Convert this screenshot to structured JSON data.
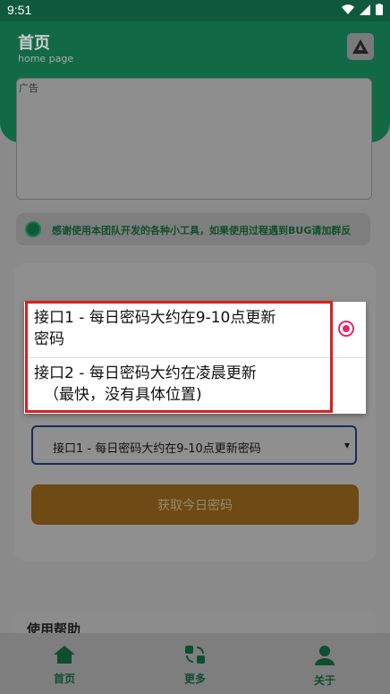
{
  "status": {
    "time": "9:51"
  },
  "header": {
    "title": "首页",
    "subtitle": "home page"
  },
  "ad": {
    "alt": "广告"
  },
  "notice": {
    "text": "感谢使用本团队开发的各种小工具，如果使用过程遇到BUG请加群反"
  },
  "select": {
    "value": "接口1 - 每日密码大约在9-10点更新密码"
  },
  "button": {
    "label": "获取今日密码"
  },
  "help": {
    "title": "使用帮助"
  },
  "dropdown": {
    "options": [
      {
        "line1": "接口1 - 每日密码大约在9-10点更新",
        "line2": "密码",
        "selected": true
      },
      {
        "line1": "接口2 - 每日密码大约在凌晨更新",
        "line2": "（最快，没有具体位置)",
        "selected": false
      }
    ]
  },
  "nav": {
    "items": [
      {
        "label": "首页",
        "icon": "home-icon"
      },
      {
        "label": "更多",
        "icon": "more-icon"
      },
      {
        "label": "关于",
        "icon": "person-icon"
      }
    ]
  },
  "colors": {
    "brand": "#116a45",
    "accent": "#e0286a",
    "highlight": "#d62020"
  }
}
